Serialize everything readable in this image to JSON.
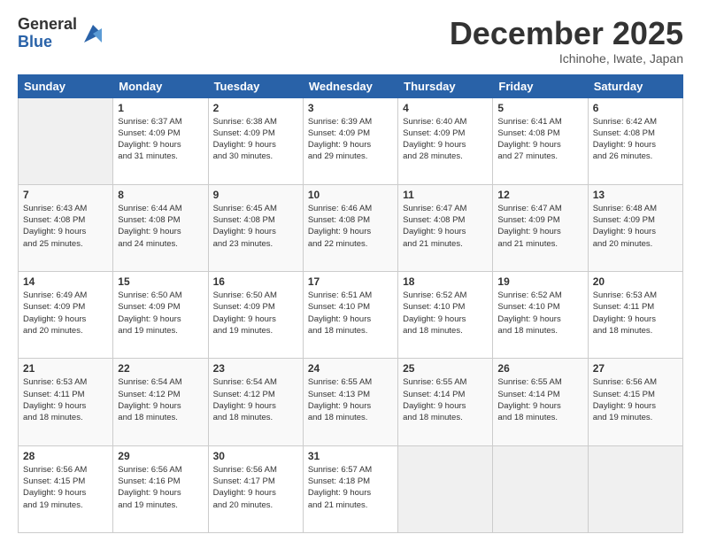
{
  "logo": {
    "general": "General",
    "blue": "Blue"
  },
  "header": {
    "month": "December 2025",
    "location": "Ichinohe, Iwate, Japan"
  },
  "weekdays": [
    "Sunday",
    "Monday",
    "Tuesday",
    "Wednesday",
    "Thursday",
    "Friday",
    "Saturday"
  ],
  "weeks": [
    [
      {
        "day": "",
        "info": ""
      },
      {
        "day": "1",
        "info": "Sunrise: 6:37 AM\nSunset: 4:09 PM\nDaylight: 9 hours\nand 31 minutes."
      },
      {
        "day": "2",
        "info": "Sunrise: 6:38 AM\nSunset: 4:09 PM\nDaylight: 9 hours\nand 30 minutes."
      },
      {
        "day": "3",
        "info": "Sunrise: 6:39 AM\nSunset: 4:09 PM\nDaylight: 9 hours\nand 29 minutes."
      },
      {
        "day": "4",
        "info": "Sunrise: 6:40 AM\nSunset: 4:09 PM\nDaylight: 9 hours\nand 28 minutes."
      },
      {
        "day": "5",
        "info": "Sunrise: 6:41 AM\nSunset: 4:08 PM\nDaylight: 9 hours\nand 27 minutes."
      },
      {
        "day": "6",
        "info": "Sunrise: 6:42 AM\nSunset: 4:08 PM\nDaylight: 9 hours\nand 26 minutes."
      }
    ],
    [
      {
        "day": "7",
        "info": "Sunrise: 6:43 AM\nSunset: 4:08 PM\nDaylight: 9 hours\nand 25 minutes."
      },
      {
        "day": "8",
        "info": "Sunrise: 6:44 AM\nSunset: 4:08 PM\nDaylight: 9 hours\nand 24 minutes."
      },
      {
        "day": "9",
        "info": "Sunrise: 6:45 AM\nSunset: 4:08 PM\nDaylight: 9 hours\nand 23 minutes."
      },
      {
        "day": "10",
        "info": "Sunrise: 6:46 AM\nSunset: 4:08 PM\nDaylight: 9 hours\nand 22 minutes."
      },
      {
        "day": "11",
        "info": "Sunrise: 6:47 AM\nSunset: 4:08 PM\nDaylight: 9 hours\nand 21 minutes."
      },
      {
        "day": "12",
        "info": "Sunrise: 6:47 AM\nSunset: 4:09 PM\nDaylight: 9 hours\nand 21 minutes."
      },
      {
        "day": "13",
        "info": "Sunrise: 6:48 AM\nSunset: 4:09 PM\nDaylight: 9 hours\nand 20 minutes."
      }
    ],
    [
      {
        "day": "14",
        "info": "Sunrise: 6:49 AM\nSunset: 4:09 PM\nDaylight: 9 hours\nand 20 minutes."
      },
      {
        "day": "15",
        "info": "Sunrise: 6:50 AM\nSunset: 4:09 PM\nDaylight: 9 hours\nand 19 minutes."
      },
      {
        "day": "16",
        "info": "Sunrise: 6:50 AM\nSunset: 4:09 PM\nDaylight: 9 hours\nand 19 minutes."
      },
      {
        "day": "17",
        "info": "Sunrise: 6:51 AM\nSunset: 4:10 PM\nDaylight: 9 hours\nand 18 minutes."
      },
      {
        "day": "18",
        "info": "Sunrise: 6:52 AM\nSunset: 4:10 PM\nDaylight: 9 hours\nand 18 minutes."
      },
      {
        "day": "19",
        "info": "Sunrise: 6:52 AM\nSunset: 4:10 PM\nDaylight: 9 hours\nand 18 minutes."
      },
      {
        "day": "20",
        "info": "Sunrise: 6:53 AM\nSunset: 4:11 PM\nDaylight: 9 hours\nand 18 minutes."
      }
    ],
    [
      {
        "day": "21",
        "info": "Sunrise: 6:53 AM\nSunset: 4:11 PM\nDaylight: 9 hours\nand 18 minutes."
      },
      {
        "day": "22",
        "info": "Sunrise: 6:54 AM\nSunset: 4:12 PM\nDaylight: 9 hours\nand 18 minutes."
      },
      {
        "day": "23",
        "info": "Sunrise: 6:54 AM\nSunset: 4:12 PM\nDaylight: 9 hours\nand 18 minutes."
      },
      {
        "day": "24",
        "info": "Sunrise: 6:55 AM\nSunset: 4:13 PM\nDaylight: 9 hours\nand 18 minutes."
      },
      {
        "day": "25",
        "info": "Sunrise: 6:55 AM\nSunset: 4:14 PM\nDaylight: 9 hours\nand 18 minutes."
      },
      {
        "day": "26",
        "info": "Sunrise: 6:55 AM\nSunset: 4:14 PM\nDaylight: 9 hours\nand 18 minutes."
      },
      {
        "day": "27",
        "info": "Sunrise: 6:56 AM\nSunset: 4:15 PM\nDaylight: 9 hours\nand 19 minutes."
      }
    ],
    [
      {
        "day": "28",
        "info": "Sunrise: 6:56 AM\nSunset: 4:15 PM\nDaylight: 9 hours\nand 19 minutes."
      },
      {
        "day": "29",
        "info": "Sunrise: 6:56 AM\nSunset: 4:16 PM\nDaylight: 9 hours\nand 19 minutes."
      },
      {
        "day": "30",
        "info": "Sunrise: 6:56 AM\nSunset: 4:17 PM\nDaylight: 9 hours\nand 20 minutes."
      },
      {
        "day": "31",
        "info": "Sunrise: 6:57 AM\nSunset: 4:18 PM\nDaylight: 9 hours\nand 21 minutes."
      },
      {
        "day": "",
        "info": ""
      },
      {
        "day": "",
        "info": ""
      },
      {
        "day": "",
        "info": ""
      }
    ]
  ]
}
